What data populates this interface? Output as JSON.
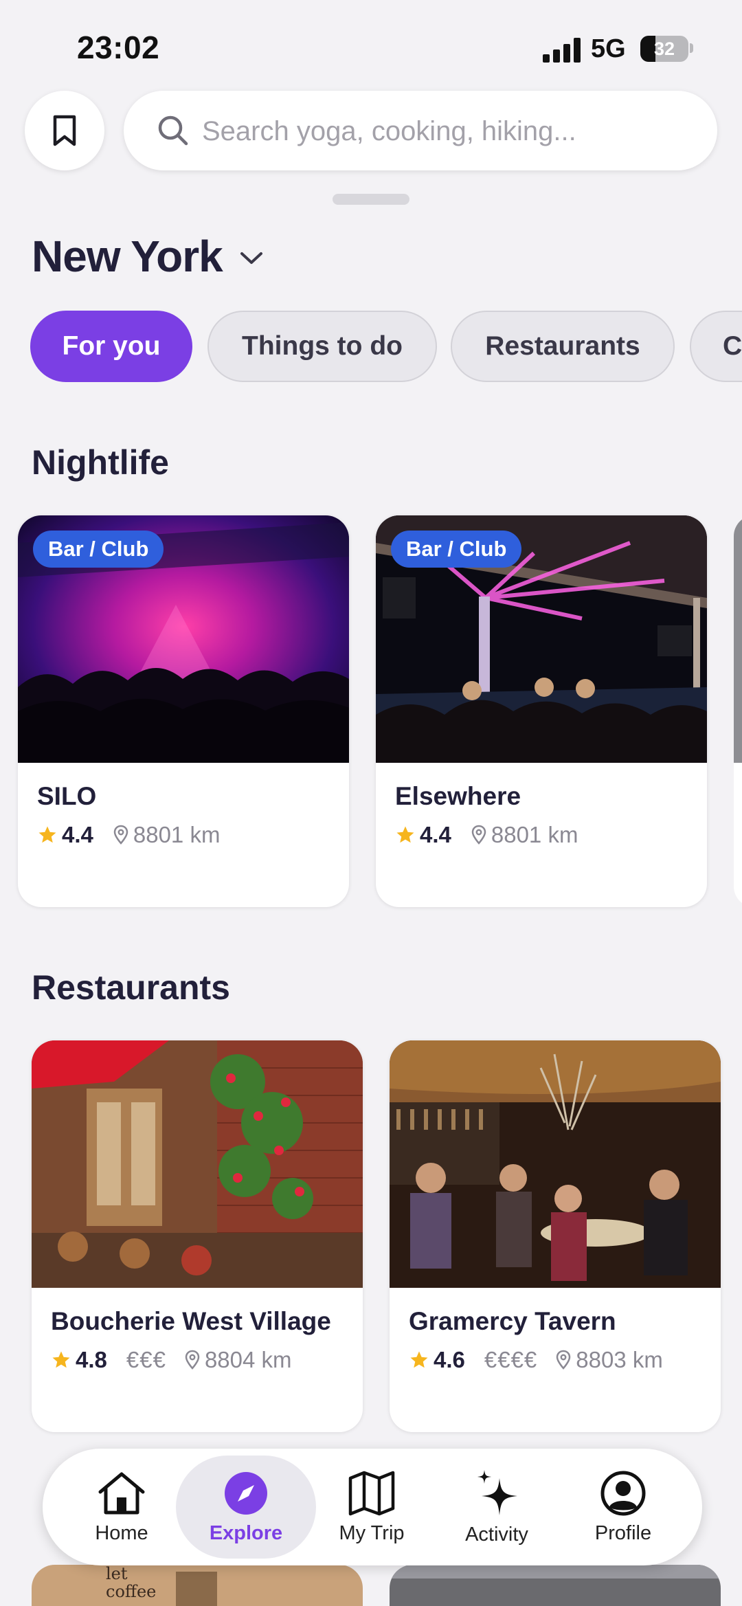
{
  "status_bar": {
    "time": "23:02",
    "network": "5G",
    "battery": "32",
    "battery_level": 0.32
  },
  "search": {
    "placeholder": "Search yoga, cooking, hiking..."
  },
  "location": {
    "city": "New York"
  },
  "filters": [
    {
      "label": "For you",
      "active": true
    },
    {
      "label": "Things to do",
      "active": false
    },
    {
      "label": "Restaurants",
      "active": false
    },
    {
      "label": "C",
      "active": false
    }
  ],
  "sections": {
    "nightlife": {
      "title": "Nightlife",
      "items": [
        {
          "badge": "Bar / Club",
          "name": "SILO",
          "rating": "4.4",
          "distance": "8801 km"
        },
        {
          "badge": "Bar / Club",
          "name": "Elsewhere",
          "rating": "4.4",
          "distance": "8801 km"
        }
      ]
    },
    "restaurants": {
      "title": "Restaurants",
      "items": [
        {
          "name": "Boucherie West Village",
          "rating": "4.8",
          "price": "€€€",
          "distance": "8804 km"
        },
        {
          "name": "Gramercy Tavern",
          "rating": "4.6",
          "price": "€€€€",
          "distance": "8803 km"
        }
      ]
    },
    "cafes": {
      "peek_sign_text": "let coffee"
    }
  },
  "bottom_nav": [
    {
      "label": "Home",
      "icon": "home-icon",
      "active": false
    },
    {
      "label": "Explore",
      "icon": "compass-icon",
      "active": true
    },
    {
      "label": "My Trip",
      "icon": "map-icon",
      "active": false
    },
    {
      "label": "Activity",
      "icon": "sparkle-icon",
      "active": false
    },
    {
      "label": "Profile",
      "icon": "profile-icon",
      "active": false
    }
  ],
  "colors": {
    "accent": "#7b3fe4",
    "badge": "#2f5fdc",
    "star": "#f6b51e",
    "background": "#f3f2f5"
  }
}
